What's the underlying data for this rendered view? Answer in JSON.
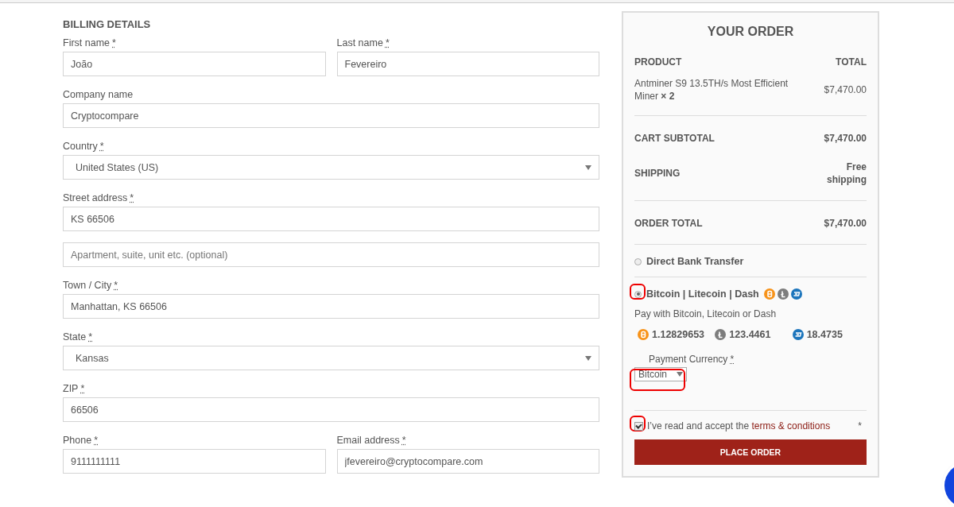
{
  "billing": {
    "title": "BILLING DETAILS",
    "rows": [
      [
        {
          "kind": "text",
          "label": "First name",
          "required_mark": "*",
          "value": "João"
        },
        {
          "kind": "text",
          "label": "Last name",
          "required_mark": "*",
          "value": "Fevereiro"
        }
      ],
      [
        {
          "kind": "text",
          "label": "Company name",
          "value": "Cryptocompare"
        }
      ],
      [
        {
          "kind": "select",
          "label": "Country",
          "required_mark": "*",
          "value": "United States (US)"
        }
      ],
      [
        {
          "kind": "text",
          "label": "Street address",
          "required_mark": "*",
          "value": "KS 66506"
        }
      ],
      [
        {
          "kind": "text",
          "placeholder": "Apartment, suite, unit etc. (optional)"
        }
      ],
      [
        {
          "kind": "text",
          "label": "Town / City",
          "required_mark": "*",
          "value": "Manhattan, KS 66506"
        }
      ],
      [
        {
          "kind": "select",
          "label": "State",
          "required_mark": "*",
          "value": "Kansas"
        }
      ],
      [
        {
          "kind": "text",
          "label": "ZIP",
          "required_mark": "*",
          "value": "66506"
        }
      ],
      [
        {
          "kind": "text",
          "label": "Phone",
          "required_mark": "*",
          "value": "9111111111"
        },
        {
          "kind": "text",
          "label": "Email address",
          "required_mark": "*",
          "value": "jfevereiro@cryptocompare.com"
        }
      ]
    ]
  },
  "order": {
    "title": "YOUR ORDER",
    "columns": [
      "PRODUCT",
      "TOTAL"
    ],
    "items": [
      {
        "name": "Antminer S9 13.5TH/s Most Efficient Miner **× 2**",
        "total": "$7,470.00"
      }
    ],
    "totals": [
      {
        "label": "CART SUBTOTAL",
        "value": "$7,470.00",
        "divider": false
      },
      {
        "label": "SHIPPING",
        "value": "Free shipping",
        "divider": false
      },
      {
        "label": "ORDER TOTAL",
        "value": "$7,470.00",
        "divider": true
      }
    ],
    "payment_methods": [
      {
        "label": "Direct Bank Transfer",
        "selected": false,
        "highlighted": false
      },
      {
        "label": "Bitcoin | Litecoin | Dash",
        "selected": true,
        "highlighted": true,
        "coin_icons": [
          {
            "color": "#f7931a"
          },
          {
            "color": "#7d7d7d"
          },
          {
            "color": "#1c75bc"
          }
        ],
        "description": "Pay with Bitcoin, Litecoin or Dash",
        "crypto_amounts": [
          {
            "amount": "1.12829653",
            "color": "#f7931a"
          },
          {
            "amount": "123.4461",
            "color": "#7d7d7d"
          },
          {
            "amount": "18.4735",
            "color": "#1c75bc"
          }
        ],
        "currency": {
          "label": "Payment Currency",
          "required_mark": "*",
          "value": "Bitcoin",
          "highlighted": true
        }
      }
    ],
    "terms": {
      "text": "I’ve read and accept the",
      "link": "terms & conditions",
      "required_mark": "*",
      "checked": true,
      "highlighted": true
    },
    "button": "PLACE ORDER"
  }
}
